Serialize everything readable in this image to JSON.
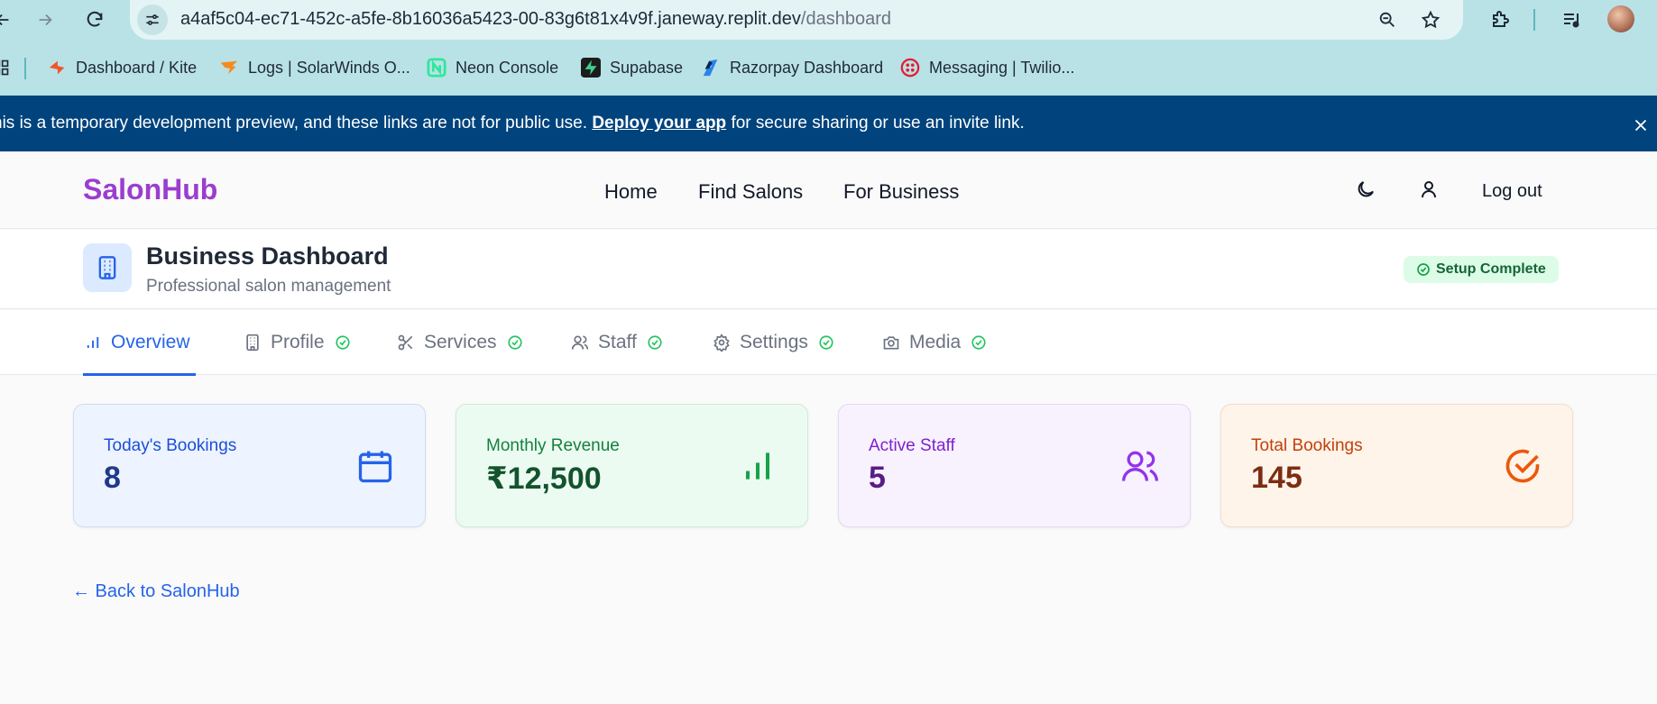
{
  "browser": {
    "url_host": "a4af5c04-ec71-452c-a5fe-8b16036a5423-00-83g6t81x4v9f.janeway.replit.dev",
    "url_path": "/dashboard",
    "bookmarks": [
      {
        "label": "Dashboard / Kite",
        "icon": "kite-icon",
        "color": "#f0562c"
      },
      {
        "label": "Logs | SolarWinds O...",
        "icon": "solarwinds-icon",
        "color": "#f78a1d"
      },
      {
        "label": "Neon Console",
        "icon": "neon-icon",
        "color": "#2ee89a"
      },
      {
        "label": "Supabase",
        "icon": "supabase-icon",
        "color": "#3ecf8e"
      },
      {
        "label": "Razorpay Dashboard",
        "icon": "razorpay-icon",
        "color": "#2b83ea"
      },
      {
        "label": "Messaging | Twilio...",
        "icon": "twilio-icon",
        "color": "#e31e34"
      }
    ]
  },
  "banner": {
    "text_before": "his is a temporary development preview, and these links are not for public use.",
    "link": "Deploy your app",
    "text_after": "for secure sharing or use an invite link."
  },
  "header": {
    "logo": "SalonHub",
    "nav": [
      "Home",
      "Find Salons",
      "For Business"
    ],
    "logout": "Log out"
  },
  "dashboard": {
    "title": "Business Dashboard",
    "subtitle": "Professional salon management",
    "status": "Setup Complete"
  },
  "tabs": [
    {
      "label": "Overview",
      "icon": "bar-chart-icon",
      "active": true,
      "check": false
    },
    {
      "label": "Profile",
      "icon": "building-icon",
      "active": false,
      "check": true
    },
    {
      "label": "Services",
      "icon": "scissors-icon",
      "active": false,
      "check": true
    },
    {
      "label": "Staff",
      "icon": "users-icon",
      "active": false,
      "check": true
    },
    {
      "label": "Settings",
      "icon": "gear-icon",
      "active": false,
      "check": true
    },
    {
      "label": "Media",
      "icon": "camera-icon",
      "active": false,
      "check": true
    }
  ],
  "stats": [
    {
      "label": "Today's Bookings",
      "value": "8",
      "icon": "calendar-icon",
      "bg": "#eef4ff",
      "border": "#cfdcf5",
      "label_color": "#1d4ed8",
      "value_color": "#1e3a8a",
      "icon_color": "#2563eb"
    },
    {
      "label": "Monthly Revenue",
      "value": "₹12,500",
      "icon": "bar-chart-icon",
      "bg": "#ecfbf1",
      "border": "#cdebd8",
      "label_color": "#15803d",
      "value_color": "#14532d",
      "icon_color": "#16a34a"
    },
    {
      "label": "Active Staff",
      "value": "5",
      "icon": "users-icon",
      "bg": "#f8f2fe",
      "border": "#e6d8f5",
      "label_color": "#7e22ce",
      "value_color": "#581c87",
      "icon_color": "#9333ea"
    },
    {
      "label": "Total Bookings",
      "value": "145",
      "icon": "check-circle-icon",
      "bg": "#fff4ea",
      "border": "#f3ddc9",
      "label_color": "#c2410c",
      "value_color": "#7c2d12",
      "icon_color": "#ea580c"
    }
  ],
  "back_link": "← Back to SalonHub"
}
